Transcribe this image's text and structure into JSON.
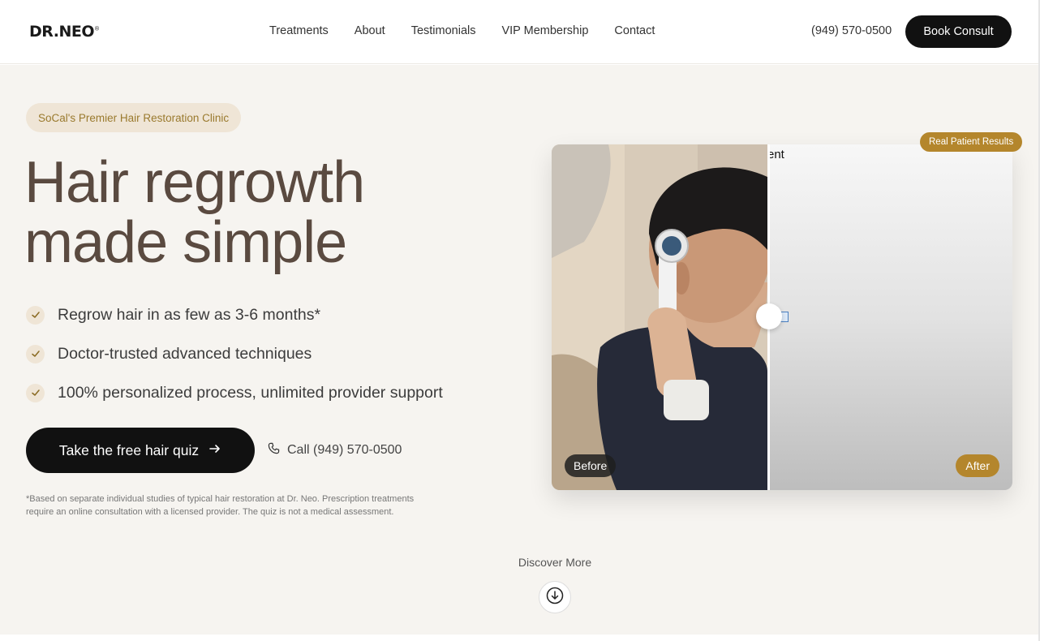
{
  "brand": {
    "logo": "DR.NEO",
    "logo_mark": "®"
  },
  "nav": {
    "items": [
      "Treatments",
      "About",
      "Testimonials",
      "VIP Membership",
      "Contact"
    ],
    "phone": "(949) 570-0500",
    "cta": "Book Consult"
  },
  "hero": {
    "pill": "SoCal's Premier Hair Restoration Clinic",
    "headline_line1": "Hair regrowth",
    "headline_line2": "made simple",
    "features": [
      "Regrow hair in as few as 3-6 months*",
      "Doctor-trusted advanced techniques",
      "100% personalized process, unlimited provider support"
    ],
    "primary_cta": "Take the free hair quiz",
    "call_cta": "Call (949) 570-0500",
    "disclaimer": "*Based on separate individual studies of typical hair restoration at Dr. Neo. Prescription treatments require an online consultation with a licensed provider. The quiz is not a medical assessment."
  },
  "compare": {
    "badge": "Real Patient Results",
    "before_label": "Before",
    "after_label": "After",
    "partial_alt_text": "ent",
    "slider_position": 0.47
  },
  "discover": {
    "label": "Discover More"
  },
  "icons": {
    "check": "check-icon",
    "arrow_right": "arrow-right-icon",
    "phone": "phone-icon",
    "arrow_down_circle": "arrow-down-circle-icon"
  },
  "colors": {
    "accent_gold": "#b4862c",
    "pill_bg": "#efe5d6",
    "headline": "#5a4a40",
    "dark_button": "#111111",
    "hero_bg": "#f6f4f0"
  }
}
